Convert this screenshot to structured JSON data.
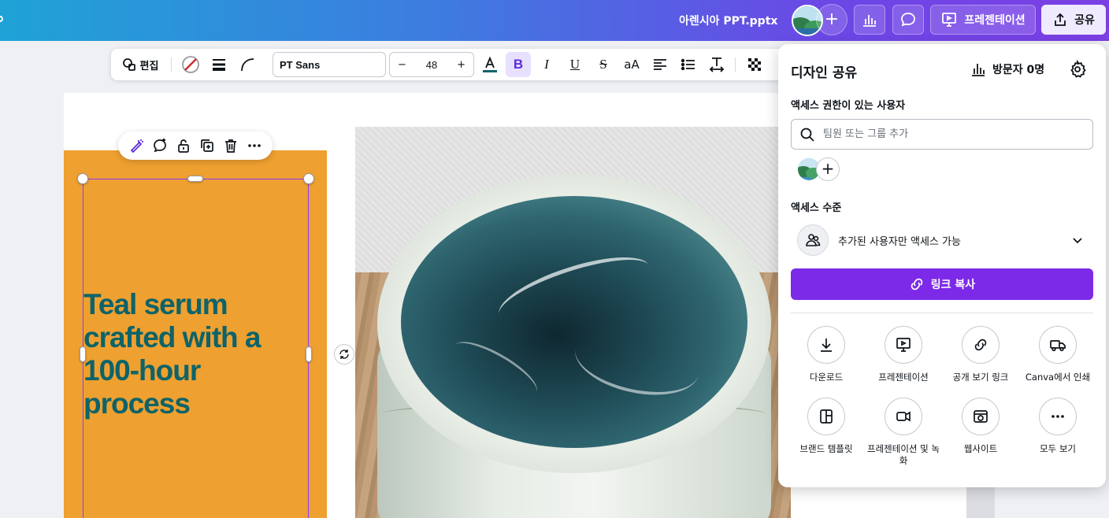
{
  "header": {
    "file_title": "아렌시아 PPT.pptx",
    "present_label": "프레젠테이션",
    "share_label": "공유"
  },
  "text_toolbar": {
    "edit_label": "편집",
    "font_name": "PT Sans",
    "font_size": "48",
    "minus": "−",
    "plus": "+",
    "case_label": "aA"
  },
  "canvas": {
    "headline": "Teal serum crafted with a 100-hour process",
    "text_color": "#0d6369",
    "panel_color": "#eea030"
  },
  "share_panel": {
    "title": "디자인 공유",
    "visitors": "방문자 0명",
    "access_users_label": "액세스 권한이 있는 사용자",
    "search_placeholder": "팀원 또는 그룹 추가",
    "access_level_label": "액세스 수준",
    "access_level_value": "추가된 사용자만 액세스 가능",
    "copy_link_label": "링크 복사",
    "accent_color": "#7d2ae8",
    "actions": [
      {
        "label": "다운로드",
        "icon": "download-icon"
      },
      {
        "label": "프레젠테이션",
        "icon": "present-icon"
      },
      {
        "label": "공개 보기 링크",
        "icon": "link-icon"
      },
      {
        "label": "Canva에서 인쇄",
        "icon": "truck-icon"
      },
      {
        "label": "브랜드 템플릿",
        "icon": "template-icon"
      },
      {
        "label": "프레젠테이션 및 녹화",
        "icon": "record-icon"
      },
      {
        "label": "웹사이트",
        "icon": "website-icon"
      },
      {
        "label": "모두 보기",
        "icon": "more-icon"
      }
    ]
  }
}
